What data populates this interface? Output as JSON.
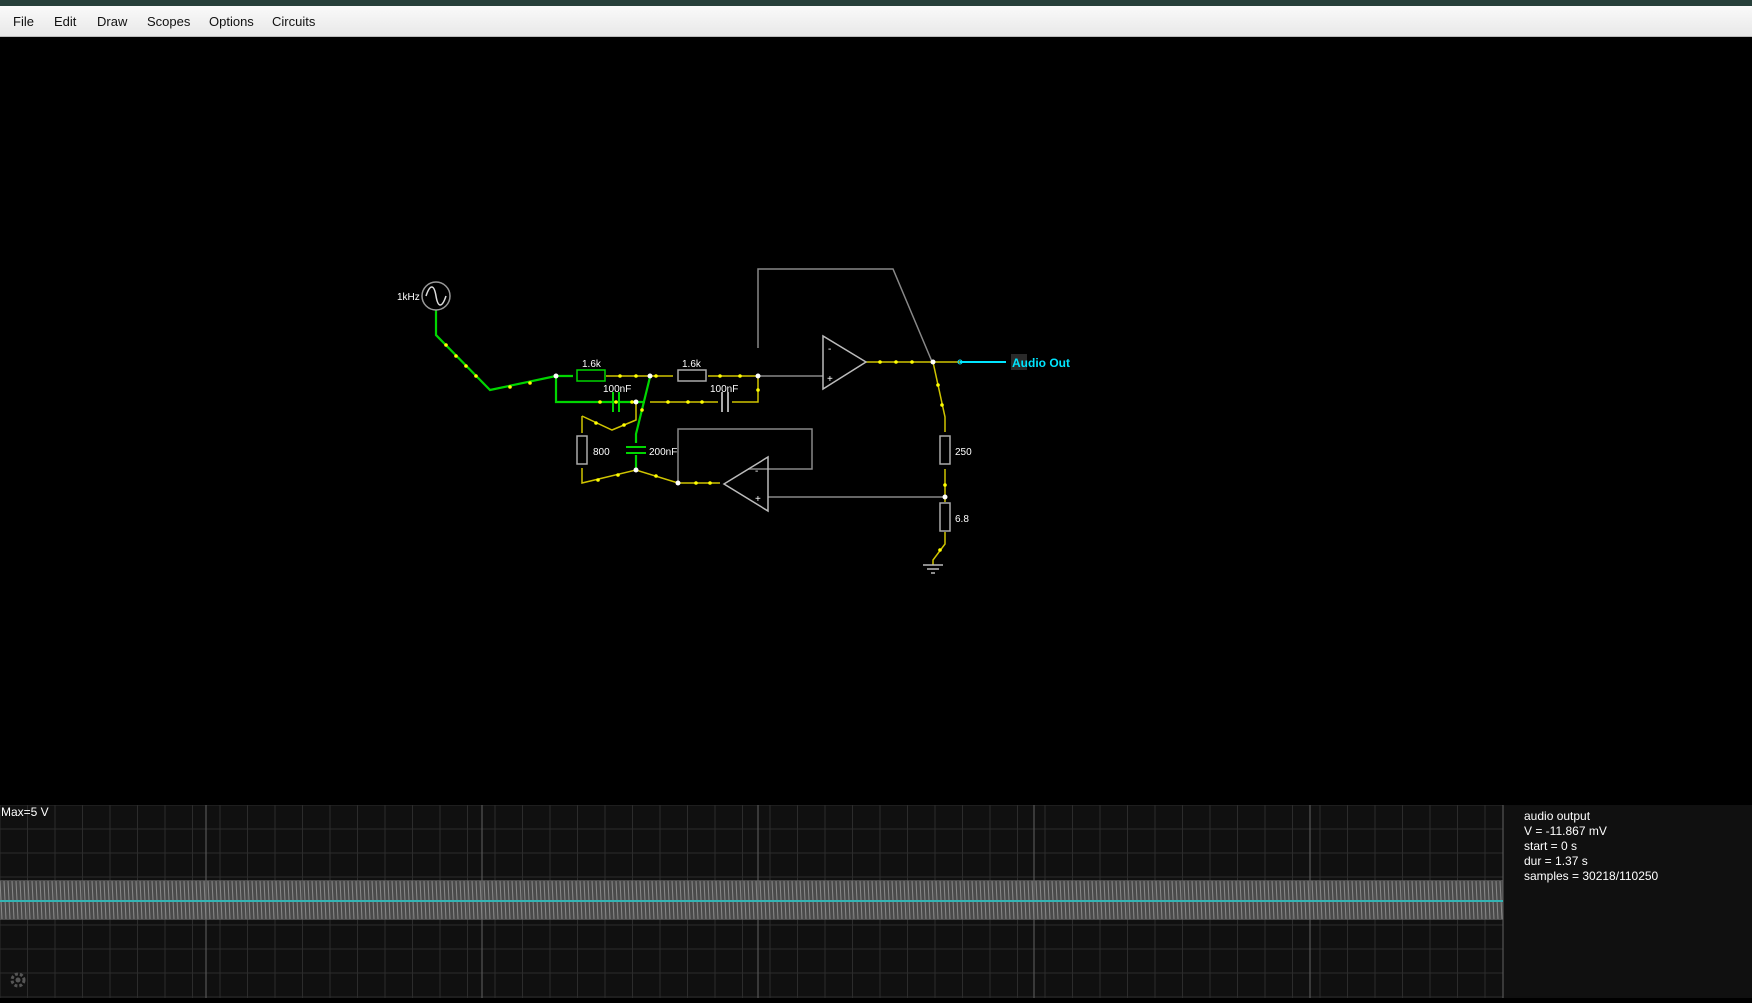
{
  "menu": [
    "File",
    "Edit",
    "Draw",
    "Scopes",
    "Options",
    "Circuits"
  ],
  "circuit": {
    "source_label": "1kHz",
    "r1_label": "1.6k",
    "r2_label": "1.6k",
    "c1_label": "100nF",
    "c2_label": "100nF",
    "r3_label": "800",
    "c3_label": "200nF",
    "r4_label": "250",
    "r5_label": "6.8",
    "output_label": "Audio Out",
    "opamp_minus": "-",
    "opamp_plus": "+"
  },
  "scope": {
    "max_label": "Max=5 V",
    "info": [
      "audio output",
      "V = -11.867 mV",
      "start = 0 s",
      "dur = 1.37 s",
      "samples = 30218/110250"
    ]
  },
  "colors": {
    "background": "#000000",
    "wire_active": "#00d600",
    "current_dot": "#ffff00",
    "component": "#888888",
    "output": "#00e5ff"
  },
  "icons": [
    "ac-source-icon",
    "resistor-icon",
    "capacitor-icon",
    "opamp-icon",
    "ground-icon",
    "gear-icon"
  ]
}
